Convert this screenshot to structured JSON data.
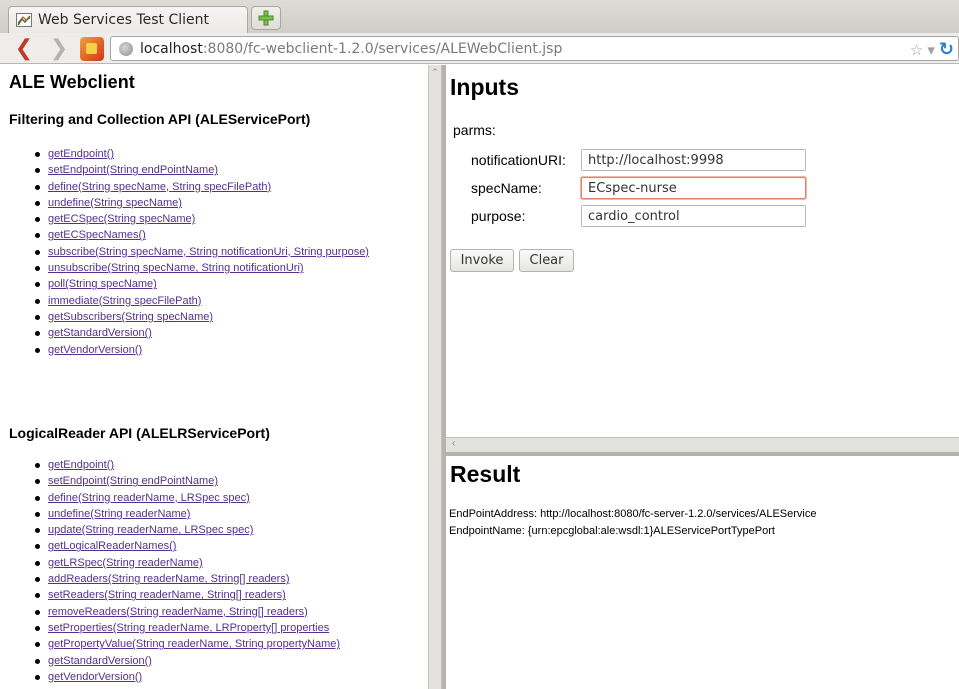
{
  "browser": {
    "tab_title": "Web Services Test Client",
    "url_host": "localhost",
    "url_rest": ":8080/fc-webclient-1.2.0/services/ALEWebClient.jsp"
  },
  "left": {
    "title": "ALE Webclient",
    "section1": {
      "title": "Filtering and Collection API (ALEServicePort)",
      "items": [
        "getEndpoint()",
        "setEndpoint(String endPointName)",
        "define(String specName, String specFilePath)",
        "undefine(String specName)",
        "getECSpec(String specName)",
        "getECSpecNames()",
        "subscribe(String specName, String notificationUri, String purpose)",
        "unsubscribe(String specName, String notificationUri)",
        "poll(String specName)",
        "immediate(String specFilePath)",
        "getSubscribers(String specName)",
        "getStandardVersion()",
        "getVendorVersion()"
      ]
    },
    "section2": {
      "title": "LogicalReader API (ALELRServicePort)",
      "items": [
        "getEndpoint()",
        "setEndpoint(String endPointName)",
        "define(String readerName, LRSpec spec)",
        "undefine(String readerName)",
        "update(String readerName, LRSpec spec)",
        "getLogicalReaderNames()",
        "getLRSpec(String readerName)",
        "addReaders(String readerName, String[] readers)",
        "setReaders(String readerName, String[] readers)",
        "removeReaders(String readerName, String[] readers)",
        "setProperties(String readerName, LRProperty[] properties",
        "getPropertyValue(String readerName, String propertyName)",
        "getStandardVersion()",
        "getVendorVersion()"
      ]
    }
  },
  "inputs": {
    "title": "Inputs",
    "parms_label": "parms:",
    "fields": [
      {
        "label": "notificationURI:",
        "value": "http://localhost:9998"
      },
      {
        "label": "specName:",
        "value": "ECspec-nurse"
      },
      {
        "label": "purpose:",
        "value": "cardio_control"
      }
    ],
    "invoke_label": "Invoke",
    "clear_label": "Clear"
  },
  "result": {
    "title": "Result",
    "lines": [
      "EndPointAddress: http://localhost:8080/fc-server-1.2.0/services/ALEService",
      "EndpointName: {urn:epcglobal:ale:wsdl:1}ALEServicePortTypePort"
    ]
  },
  "colors": {
    "link": "#55308e",
    "focus_border": "#e0826b"
  },
  "icons": {
    "back": "back-arrow-icon",
    "forward": "forward-arrow-icon",
    "reload": "reload-icon",
    "bookmark": "star-icon"
  }
}
